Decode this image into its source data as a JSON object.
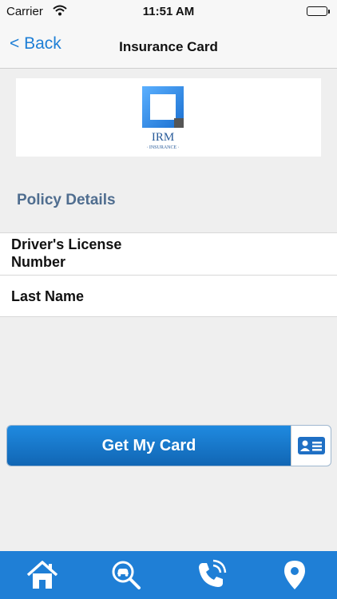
{
  "status_bar": {
    "carrier": "Carrier",
    "time": "11:51 AM",
    "wifi_icon": "wifi-icon",
    "battery_icon": "battery-icon"
  },
  "nav": {
    "back_label": "< Back",
    "title": "Insurance Card"
  },
  "logo": {
    "text": "IRM",
    "subtext": "· INSURANCE ·"
  },
  "policy": {
    "section_title": "Policy Details",
    "fields": [
      {
        "label": "Driver's License Number"
      },
      {
        "label": "Last Name"
      }
    ]
  },
  "actions": {
    "get_card_label": "Get My Card",
    "card_icon": "id-card-icon"
  },
  "tab_bar": {
    "tabs": [
      {
        "icon": "home-icon"
      },
      {
        "icon": "car-search-icon"
      },
      {
        "icon": "phone-icon"
      },
      {
        "icon": "location-pin-icon"
      }
    ]
  },
  "colors": {
    "accent": "#1f7fd6",
    "section_title": "#4f6d8f",
    "background": "#efefef"
  }
}
